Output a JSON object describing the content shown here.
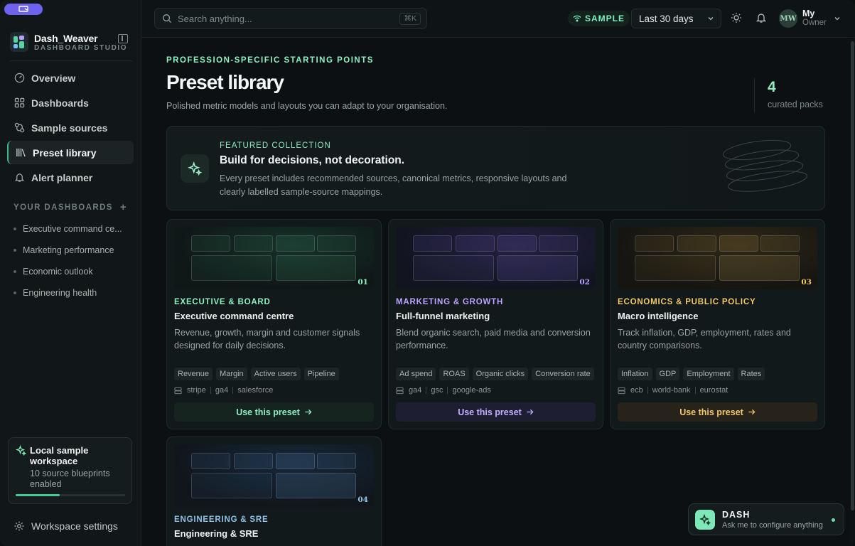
{
  "brand": {
    "name": "Dash_Weaver",
    "subtitle": "DASHBOARD STUDIO"
  },
  "nav": [
    {
      "label": "Overview",
      "icon": "gauge-icon"
    },
    {
      "label": "Dashboards",
      "icon": "grid-icon"
    },
    {
      "label": "Sample sources",
      "icon": "sources-icon"
    },
    {
      "label": "Preset library",
      "icon": "library-icon",
      "active": true
    },
    {
      "label": "Alert planner",
      "icon": "bell-icon"
    }
  ],
  "your_dashboards": {
    "heading": "YOUR DASHBOARDS",
    "items": [
      "Executive command ce...",
      "Marketing performance",
      "Economic outlook",
      "Engineering health"
    ]
  },
  "workspace_card": {
    "title": "Local sample workspace",
    "subtitle": "10 source blueprints enabled",
    "progress": 0.4
  },
  "settings_label": "Workspace settings",
  "topbar": {
    "search_placeholder": "Search anything...",
    "search_shortcut": "⌘K",
    "sample_badge": "SAMPLE",
    "date_range": "Last 30 days",
    "user_initials": "MW",
    "user_name": "My",
    "user_role": "Owner"
  },
  "page": {
    "eyebrow": "PROFESSION-SPECIFIC STARTING POINTS",
    "title": "Preset library",
    "lead": "Polished metric models and layouts you can adapt to your organisation.",
    "stat_value": "4",
    "stat_label": "curated packs"
  },
  "featured": {
    "kicker": "FEATURED COLLECTION",
    "title": "Build for decisions, not decoration.",
    "description": "Every preset includes recommended sources, canonical metrics, responsive layouts and clearly labelled sample-source mappings."
  },
  "presets": [
    {
      "num": "01",
      "category": "EXECUTIVE & BOARD",
      "title": "Executive command centre",
      "description": "Revenue, growth, margin and customer signals designed for daily decisions.",
      "tags": [
        "Revenue",
        "Margin",
        "Active users",
        "Pipeline"
      ],
      "sources": [
        "stripe",
        "ga4",
        "salesforce"
      ],
      "button": "Use this preset",
      "accent": "#8df0c2"
    },
    {
      "num": "02",
      "category": "MARKETING & GROWTH",
      "title": "Full-funnel marketing",
      "description": "Blend organic search, paid media and conversion performance.",
      "tags": [
        "Ad spend",
        "ROAS",
        "Organic clicks",
        "Conversion rate"
      ],
      "sources": [
        "ga4",
        "gsc",
        "google-ads"
      ],
      "button": "Use this preset",
      "accent": "#b9a3ff"
    },
    {
      "num": "03",
      "category": "ECONOMICS & PUBLIC POLICY",
      "title": "Macro intelligence",
      "description": "Track inflation, GDP, employment, rates and country comparisons.",
      "tags": [
        "Inflation",
        "GDP",
        "Employment",
        "Rates"
      ],
      "sources": [
        "ecb",
        "world-bank",
        "eurostat"
      ],
      "button": "Use this preset",
      "accent": "#f2c86a"
    },
    {
      "num": "04",
      "category": "ENGINEERING & SRE",
      "title": "Engineering & SRE",
      "accent": "#8fc1ea"
    }
  ],
  "assistant": {
    "name": "DASH",
    "subtitle": "Ask me to configure anything"
  }
}
